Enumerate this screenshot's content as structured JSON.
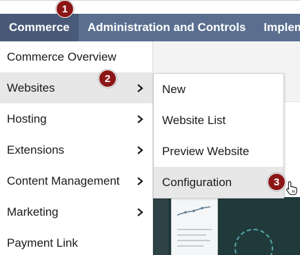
{
  "topnav": {
    "items": [
      {
        "label": "Commerce",
        "active": true
      },
      {
        "label": "Administration and Controls",
        "active": false
      },
      {
        "label": "Implemen",
        "active": false
      }
    ]
  },
  "menu": {
    "items": [
      {
        "label": "Commerce Overview",
        "has_submenu": false
      },
      {
        "label": "Websites",
        "has_submenu": true,
        "highlighted": true
      },
      {
        "label": "Hosting",
        "has_submenu": true
      },
      {
        "label": "Extensions",
        "has_submenu": true
      },
      {
        "label": "Content Management",
        "has_submenu": true
      },
      {
        "label": "Marketing",
        "has_submenu": true
      },
      {
        "label": "Payment Link",
        "has_submenu": false
      }
    ]
  },
  "submenu": {
    "items": [
      {
        "label": "New"
      },
      {
        "label": "Website List"
      },
      {
        "label": "Preview Website"
      },
      {
        "label": "Configuration",
        "highlighted": true
      }
    ]
  },
  "badges": [
    "1",
    "2",
    "3"
  ],
  "colors": {
    "navbar": "#5a6f90",
    "navbar_active": "#485a78",
    "highlight": "#e7e7e7",
    "badge": "#8c1616"
  },
  "icons": {
    "submenu_arrow": "chevron-right-icon",
    "pointer": "hand-pointer-icon"
  }
}
